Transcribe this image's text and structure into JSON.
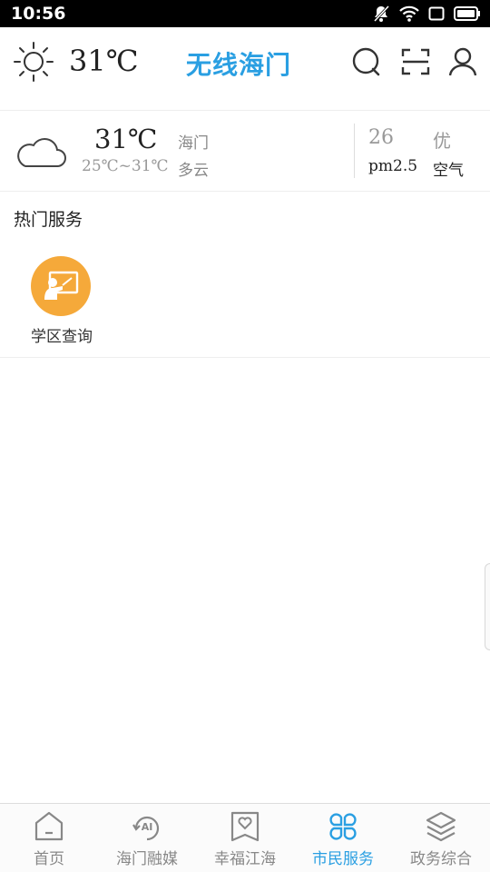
{
  "status_bar": {
    "time": "10:56",
    "icons": [
      "notifications-off-icon",
      "wifi-icon",
      "screen-icon",
      "battery-icon"
    ]
  },
  "header": {
    "weather_icon": "sun-icon",
    "temperature": "31℃",
    "app_title": "无线海门",
    "actions": [
      "search-icon",
      "scan-icon",
      "user-icon"
    ]
  },
  "weather": {
    "icon": "cloud-icon",
    "temperature": "31℃",
    "range": "25℃~31℃",
    "city": "海门",
    "condition": "多云",
    "aqi_value": "26",
    "aqi_level": "优",
    "aqi_label": "pm2.5",
    "air_label": "空气"
  },
  "hot_services": {
    "title": "热门服务",
    "items": [
      {
        "label": "学区查询",
        "icon": "teacher-board-icon",
        "color": "#f5a93a"
      }
    ]
  },
  "bottom_nav": {
    "active_index": 3,
    "items": [
      {
        "label": "首页",
        "icon": "home-icon"
      },
      {
        "label": "海门融媒",
        "icon": "media-ai-icon"
      },
      {
        "label": "幸福江海",
        "icon": "heart-badge-icon"
      },
      {
        "label": "市民服务",
        "icon": "grid-clover-icon"
      },
      {
        "label": "政务综合",
        "icon": "layers-icon"
      }
    ]
  },
  "colors": {
    "accent": "#2a9fe2",
    "service_orange": "#f5a93a",
    "inactive": "#888888"
  }
}
